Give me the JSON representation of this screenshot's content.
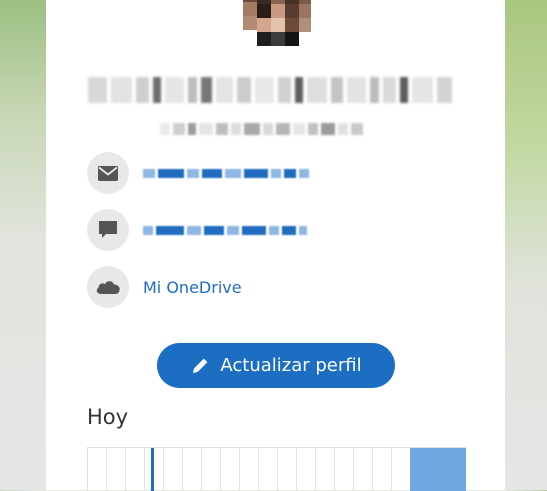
{
  "profile": {
    "name_hidden": true,
    "subtitle_hidden": true
  },
  "contacts": {
    "email_icon": "mail-icon",
    "chat_icon": "chat-icon",
    "onedrive_icon": "cloud-icon",
    "onedrive_label": "Mi OneDrive"
  },
  "actions": {
    "update_profile_label": "Actualizar perfil",
    "update_profile_icon": "pencil-icon"
  },
  "calendar": {
    "today_label": "Hoy"
  },
  "colors": {
    "accent": "#1b6ec2",
    "link": "#1f6cc0",
    "busy": "#6fa8e0",
    "icon_bg": "#e8e8e8"
  }
}
